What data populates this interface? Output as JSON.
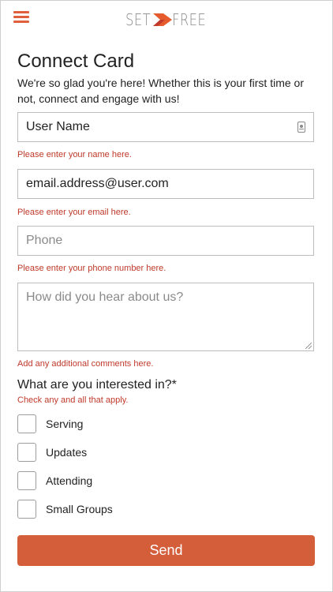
{
  "header": {
    "logo_left": "SET",
    "logo_right": "FREE",
    "menu_icon": "hamburger-menu-icon",
    "accent": "#e0603e"
  },
  "form": {
    "title": "Connect Card",
    "intro": "We're so glad you're here! Whether this is your first time or not, connect and engage with us!",
    "name": {
      "value": "User Name",
      "help": "Please enter your name here."
    },
    "email": {
      "value": "email.address@user.com",
      "help": "Please enter your email here."
    },
    "phone": {
      "value": "",
      "placeholder": "Phone",
      "help": "Please enter your phone number here."
    },
    "comments": {
      "value": "",
      "placeholder": "How did you hear about us?",
      "help": "Add any additional comments here."
    },
    "interests": {
      "question": "What are you interested in?*",
      "sub": "Check any and all that apply.",
      "options": [
        "Serving",
        "Updates",
        "Attending",
        "Small Groups"
      ]
    },
    "send_label": "Send",
    "send_color": "#d45d3a",
    "help_color": "#c0392b"
  }
}
